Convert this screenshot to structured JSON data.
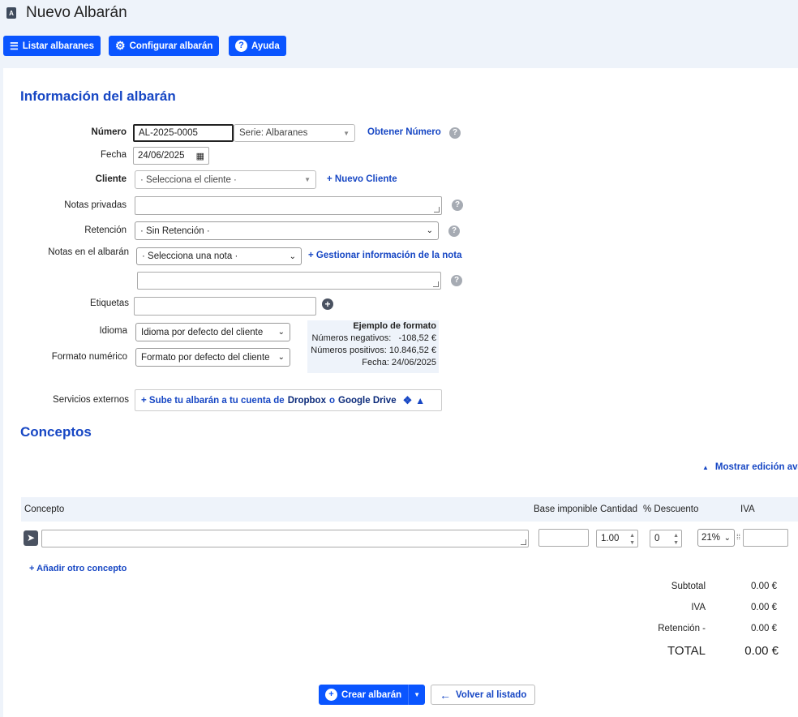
{
  "page": {
    "title": "Nuevo Albarán",
    "title_icon": "document-a-icon"
  },
  "toolbar": {
    "list_label": "Listar albaranes",
    "config_label": "Configurar albarán",
    "help_label": "Ayuda"
  },
  "info": {
    "heading": "Información del albarán",
    "numero_label": "Número",
    "numero_value": "AL-2025-0005",
    "serie_value": "Serie: Albaranes",
    "obtener_numero": "Obtener Número",
    "fecha_label": "Fecha",
    "fecha_value": "24/06/2025",
    "cliente_label": "Cliente",
    "cliente_value": "· Selecciona el cliente ·",
    "nuevo_cliente": "+ Nuevo Cliente",
    "notas_privadas_label": "Notas privadas",
    "retencion_label": "Retención",
    "retencion_value": "· Sin Retención ·",
    "notas_albaran_label": "Notas en el albarán",
    "nota_value": "· Selecciona una nota ·",
    "gestionar_nota": "+ Gestionar información de la nota",
    "etiquetas_label": "Etiquetas",
    "idioma_label": "Idioma",
    "idioma_value": "Idioma por defecto del cliente",
    "formato_label": "Formato numérico",
    "formato_value": "Formato por defecto del cliente",
    "ejemplo_title": "Ejemplo de formato",
    "ejemplo_neg": "Números negativos:   -108,52 €",
    "ejemplo_pos": "Números positivos: 10.846,52 €",
    "ejemplo_fecha": "Fecha: 24/06/2025",
    "servicios_label": "Servicios externos",
    "servicios_prefix": "+ Sube tu albarán a tu cuenta de",
    "servicios_dropbox": "Dropbox",
    "servicios_o": "o",
    "servicios_gdrive": "Google Drive"
  },
  "conceptos": {
    "heading": "Conceptos",
    "mostrar_edicion": "Mostrar edición avanzada",
    "columns": [
      "Concepto",
      "Base imponible",
      "Cantidad",
      "% Descuento",
      "IVA"
    ],
    "row": {
      "cantidad": "1.00",
      "descuento": "0",
      "iva": "21%"
    },
    "add_concept": "+ Añadir otro concepto"
  },
  "totals": [
    {
      "label": "Subtotal",
      "value": "0.00 €"
    },
    {
      "label": "IVA",
      "value": "0.00 €"
    },
    {
      "label": "Retención -",
      "value": "0.00 €"
    },
    {
      "label": "TOTAL",
      "value": "0.00 €"
    }
  ],
  "footer": {
    "create_label": "Crear albarán",
    "back_label": "Volver al listado"
  }
}
